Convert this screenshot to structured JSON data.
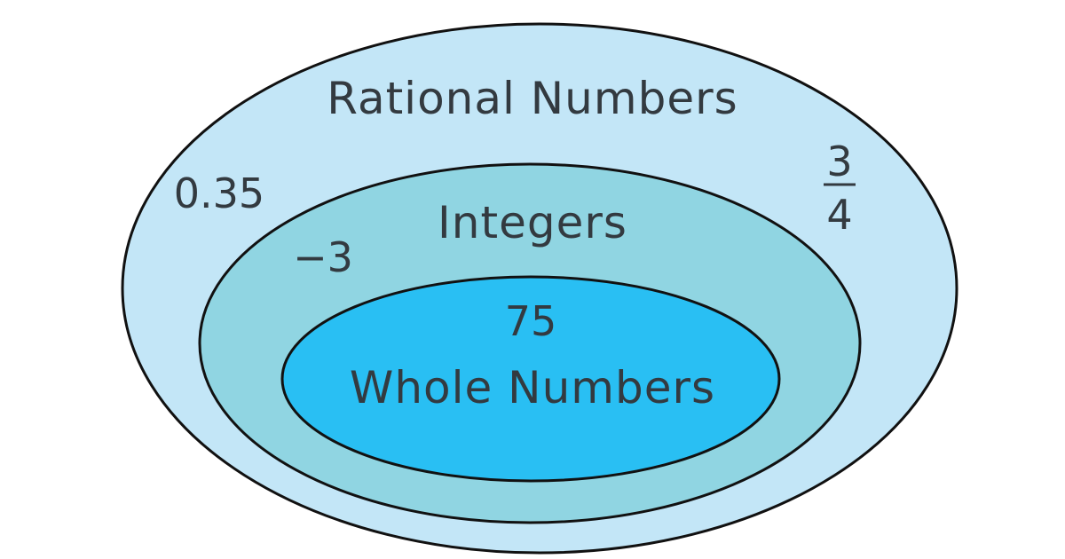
{
  "diagram": {
    "sets": [
      {
        "id": "rational",
        "label": "Rational Numbers",
        "fill": "#c3e6f7",
        "stroke": "#111111"
      },
      {
        "id": "integers",
        "label": "Integers",
        "fill": "#90d5e2",
        "stroke": "#111111"
      },
      {
        "id": "whole",
        "label": "Whole Numbers",
        "fill": "#29bff3",
        "stroke": "#111111"
      }
    ],
    "elements": {
      "decimal": "0.35",
      "negative": "−3",
      "whole": "75",
      "fraction": {
        "numerator": "3",
        "denominator": "4"
      }
    }
  }
}
